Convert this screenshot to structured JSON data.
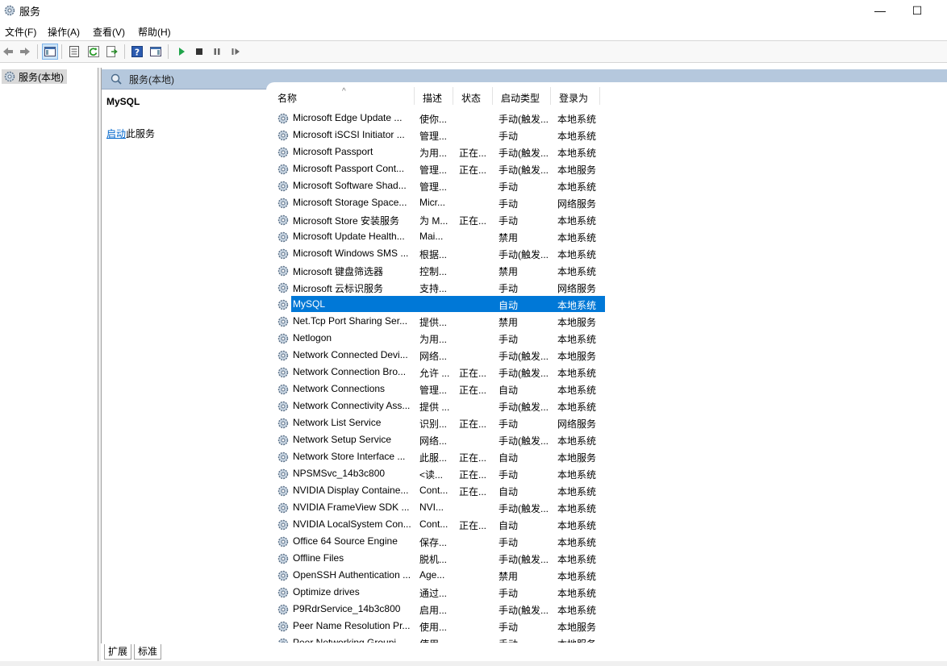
{
  "window": {
    "title": "服务",
    "minimize_glyph": "—",
    "maximize_glyph": "☐"
  },
  "menu": [
    "文件(F)",
    "操作(A)",
    "查看(V)",
    "帮助(H)"
  ],
  "tree": {
    "root_label": "服务(本地)"
  },
  "pane_header": {
    "title": "服务(本地)"
  },
  "extended_panel": {
    "service_name": "MySQL",
    "action_link": "启动",
    "action_suffix": "此服务"
  },
  "columns": {
    "name": "名称",
    "description": "描述",
    "status": "状态",
    "startup_type": "启动类型",
    "log_on_as": "登录为"
  },
  "services": [
    {
      "name": "Microsoft Edge Update ...",
      "desc": "使你...",
      "status": "",
      "startup": "手动(触发...",
      "logon": "本地系统"
    },
    {
      "name": "Microsoft iSCSI Initiator ...",
      "desc": "管理...",
      "status": "",
      "startup": "手动",
      "logon": "本地系统"
    },
    {
      "name": "Microsoft Passport",
      "desc": "为用...",
      "status": "正在...",
      "startup": "手动(触发...",
      "logon": "本地系统"
    },
    {
      "name": "Microsoft Passport Cont...",
      "desc": "管理...",
      "status": "正在...",
      "startup": "手动(触发...",
      "logon": "本地服务"
    },
    {
      "name": "Microsoft Software Shad...",
      "desc": "管理...",
      "status": "",
      "startup": "手动",
      "logon": "本地系统"
    },
    {
      "name": "Microsoft Storage Space...",
      "desc": "Micr...",
      "status": "",
      "startup": "手动",
      "logon": "网络服务"
    },
    {
      "name": "Microsoft Store 安装服务",
      "desc": "为 M...",
      "status": "正在...",
      "startup": "手动",
      "logon": "本地系统"
    },
    {
      "name": "Microsoft Update Health...",
      "desc": "Mai...",
      "status": "",
      "startup": "禁用",
      "logon": "本地系统"
    },
    {
      "name": "Microsoft Windows SMS ...",
      "desc": "根据...",
      "status": "",
      "startup": "手动(触发...",
      "logon": "本地系统"
    },
    {
      "name": "Microsoft 键盘筛选器",
      "desc": "控制...",
      "status": "",
      "startup": "禁用",
      "logon": "本地系统"
    },
    {
      "name": "Microsoft 云标识服务",
      "desc": "支持...",
      "status": "",
      "startup": "手动",
      "logon": "网络服务"
    },
    {
      "name": "MySQL",
      "desc": "",
      "status": "",
      "startup": "自动",
      "logon": "本地系统",
      "selected": true
    },
    {
      "name": "Net.Tcp Port Sharing Ser...",
      "desc": "提供...",
      "status": "",
      "startup": "禁用",
      "logon": "本地服务"
    },
    {
      "name": "Netlogon",
      "desc": "为用...",
      "status": "",
      "startup": "手动",
      "logon": "本地系统"
    },
    {
      "name": "Network Connected Devi...",
      "desc": "网络...",
      "status": "",
      "startup": "手动(触发...",
      "logon": "本地服务"
    },
    {
      "name": "Network Connection Bro...",
      "desc": "允许 ...",
      "status": "正在...",
      "startup": "手动(触发...",
      "logon": "本地系统"
    },
    {
      "name": "Network Connections",
      "desc": "管理...",
      "status": "正在...",
      "startup": "自动",
      "logon": "本地系统"
    },
    {
      "name": "Network Connectivity Ass...",
      "desc": "提供 ...",
      "status": "",
      "startup": "手动(触发...",
      "logon": "本地系统"
    },
    {
      "name": "Network List Service",
      "desc": "识别...",
      "status": "正在...",
      "startup": "手动",
      "logon": "网络服务"
    },
    {
      "name": "Network Setup Service",
      "desc": "网络...",
      "status": "",
      "startup": "手动(触发...",
      "logon": "本地系统"
    },
    {
      "name": "Network Store Interface ...",
      "desc": "此服...",
      "status": "正在...",
      "startup": "自动",
      "logon": "本地服务"
    },
    {
      "name": "NPSMSvc_14b3c800",
      "desc": "<读...",
      "status": "正在...",
      "startup": "手动",
      "logon": "本地系统"
    },
    {
      "name": "NVIDIA Display Containe...",
      "desc": "Cont...",
      "status": "正在...",
      "startup": "自动",
      "logon": "本地系统"
    },
    {
      "name": "NVIDIA FrameView SDK ...",
      "desc": "NVI...",
      "status": "",
      "startup": "手动(触发...",
      "logon": "本地系统"
    },
    {
      "name": "NVIDIA LocalSystem Con...",
      "desc": "Cont...",
      "status": "正在...",
      "startup": "自动",
      "logon": "本地系统"
    },
    {
      "name": "Office 64 Source Engine",
      "desc": "保存...",
      "status": "",
      "startup": "手动",
      "logon": "本地系统"
    },
    {
      "name": "Offline Files",
      "desc": "脱机...",
      "status": "",
      "startup": "手动(触发...",
      "logon": "本地系统"
    },
    {
      "name": "OpenSSH Authentication ...",
      "desc": "Age...",
      "status": "",
      "startup": "禁用",
      "logon": "本地系统"
    },
    {
      "name": "Optimize drives",
      "desc": "通过...",
      "status": "",
      "startup": "手动",
      "logon": "本地系统"
    },
    {
      "name": "P9RdrService_14b3c800",
      "desc": "启用...",
      "status": "",
      "startup": "手动(触发...",
      "logon": "本地系统"
    },
    {
      "name": "Peer Name Resolution Pr...",
      "desc": "使用...",
      "status": "",
      "startup": "手动",
      "logon": "本地服务"
    },
    {
      "name": "Peer Networking Groupi...",
      "desc": "使用...",
      "status": "",
      "startup": "手动",
      "logon": "本地服务"
    }
  ],
  "tabs": {
    "extended": "扩展",
    "standard": "标准"
  }
}
